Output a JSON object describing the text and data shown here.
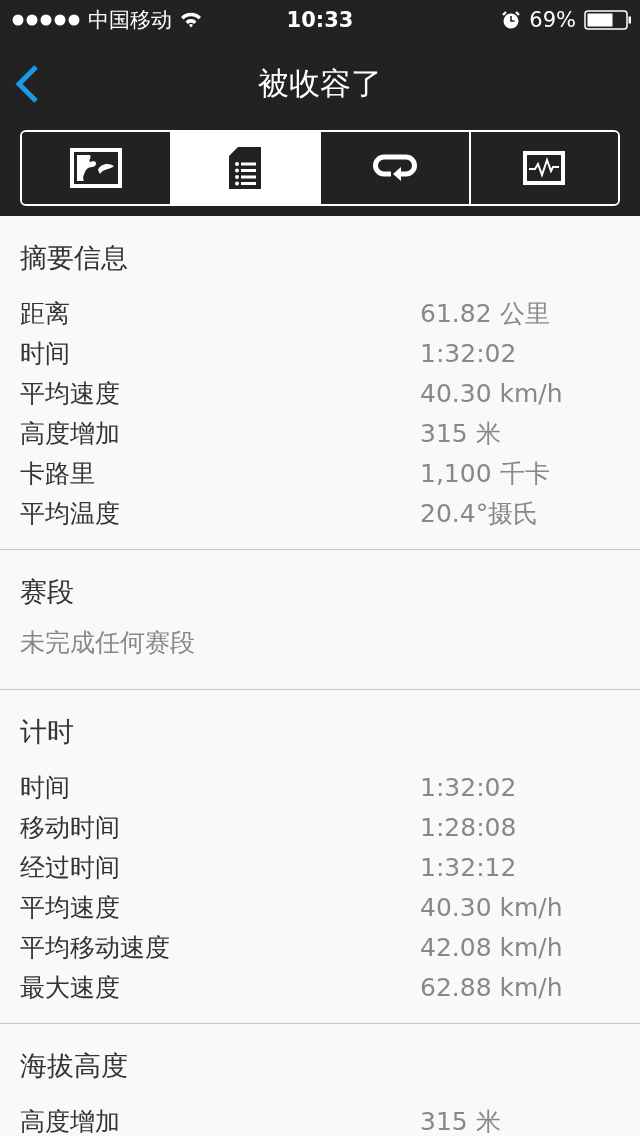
{
  "status_bar": {
    "carrier": "中国移动",
    "time": "10:33",
    "battery": "69%"
  },
  "nav": {
    "title": "被收容了"
  },
  "tabs": [
    {
      "kind": "map",
      "selected": false
    },
    {
      "kind": "details",
      "selected": true
    },
    {
      "kind": "laps",
      "selected": false
    },
    {
      "kind": "chart",
      "selected": false
    }
  ],
  "sections": [
    {
      "title": "摘要信息",
      "rows": [
        {
          "label": "距离",
          "value": "61.82 公里"
        },
        {
          "label": "时间",
          "value": "1:32:02"
        },
        {
          "label": "平均速度",
          "value": "40.30 km/h"
        },
        {
          "label": "高度增加",
          "value": "315 米"
        },
        {
          "label": "卡路里",
          "value": "1,100 千卡"
        },
        {
          "label": "平均温度",
          "value": "20.4°摄氏"
        }
      ]
    },
    {
      "title": "赛段",
      "note": "未完成任何赛段"
    },
    {
      "title": "计时",
      "rows": [
        {
          "label": "时间",
          "value": "1:32:02"
        },
        {
          "label": "移动时间",
          "value": "1:28:08"
        },
        {
          "label": "经过时间",
          "value": "1:32:12"
        },
        {
          "label": "平均速度",
          "value": "40.30 km/h"
        },
        {
          "label": "平均移动速度",
          "value": "42.08 km/h"
        },
        {
          "label": "最大速度",
          "value": "62.88 km/h"
        }
      ]
    },
    {
      "title": "海拔高度",
      "rows": [
        {
          "label": "高度增加",
          "value": "315 米"
        }
      ]
    }
  ]
}
